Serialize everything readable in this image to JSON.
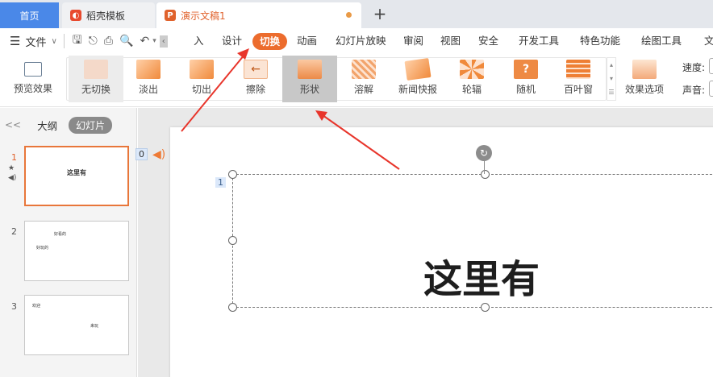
{
  "tabs": {
    "home": "首页",
    "template": "稻壳模板",
    "document": "演示文稿1",
    "new_tab": "+"
  },
  "menu": {
    "file": "文件",
    "items": [
      "入",
      "设计",
      "切换",
      "动画",
      "幻灯片放映",
      "审阅",
      "视图",
      "安全",
      "开发工具",
      "特色功能",
      "绘图工具",
      "文"
    ],
    "active": "切换"
  },
  "ribbon": {
    "preview": "预览效果",
    "effects": [
      "无切换",
      "淡出",
      "切出",
      "擦除",
      "形状",
      "溶解",
      "新闻快报",
      "轮辐",
      "随机",
      "百叶窗"
    ],
    "selected_effect": "形状",
    "effect_options": "效果选项",
    "speed_label": "速度:",
    "sound_label": "声音:"
  },
  "panel": {
    "collapse": "<<",
    "outline_tab": "大纲",
    "slides_tab": "幻灯片",
    "slides": [
      {
        "num": "1",
        "title": "这里有",
        "body": ""
      },
      {
        "num": "2",
        "title": "好看的",
        "body": "好玩的"
      },
      {
        "num": "3",
        "title": "欢迎",
        "body": "来玩"
      }
    ]
  },
  "canvas": {
    "animation_order": "0",
    "placeholder_num": "1",
    "slide_title": "这里有"
  },
  "colors": {
    "accent": "#ec6c2d",
    "home_tab": "#4a88e8",
    "arrow": "#e8352b"
  }
}
